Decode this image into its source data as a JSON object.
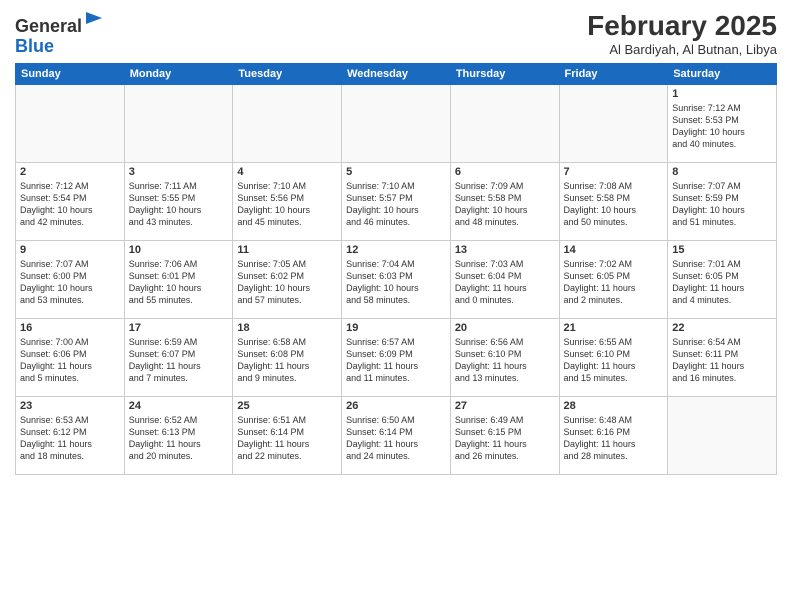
{
  "header": {
    "logo_general": "General",
    "logo_blue": "Blue",
    "month_year": "February 2025",
    "location": "Al Bardiyah, Al Butnan, Libya"
  },
  "weekdays": [
    "Sunday",
    "Monday",
    "Tuesday",
    "Wednesday",
    "Thursday",
    "Friday",
    "Saturday"
  ],
  "weeks": [
    [
      {
        "day": "",
        "info": ""
      },
      {
        "day": "",
        "info": ""
      },
      {
        "day": "",
        "info": ""
      },
      {
        "day": "",
        "info": ""
      },
      {
        "day": "",
        "info": ""
      },
      {
        "day": "",
        "info": ""
      },
      {
        "day": "1",
        "info": "Sunrise: 7:12 AM\nSunset: 5:53 PM\nDaylight: 10 hours\nand 40 minutes."
      }
    ],
    [
      {
        "day": "2",
        "info": "Sunrise: 7:12 AM\nSunset: 5:54 PM\nDaylight: 10 hours\nand 42 minutes."
      },
      {
        "day": "3",
        "info": "Sunrise: 7:11 AM\nSunset: 5:55 PM\nDaylight: 10 hours\nand 43 minutes."
      },
      {
        "day": "4",
        "info": "Sunrise: 7:10 AM\nSunset: 5:56 PM\nDaylight: 10 hours\nand 45 minutes."
      },
      {
        "day": "5",
        "info": "Sunrise: 7:10 AM\nSunset: 5:57 PM\nDaylight: 10 hours\nand 46 minutes."
      },
      {
        "day": "6",
        "info": "Sunrise: 7:09 AM\nSunset: 5:58 PM\nDaylight: 10 hours\nand 48 minutes."
      },
      {
        "day": "7",
        "info": "Sunrise: 7:08 AM\nSunset: 5:58 PM\nDaylight: 10 hours\nand 50 minutes."
      },
      {
        "day": "8",
        "info": "Sunrise: 7:07 AM\nSunset: 5:59 PM\nDaylight: 10 hours\nand 51 minutes."
      }
    ],
    [
      {
        "day": "9",
        "info": "Sunrise: 7:07 AM\nSunset: 6:00 PM\nDaylight: 10 hours\nand 53 minutes."
      },
      {
        "day": "10",
        "info": "Sunrise: 7:06 AM\nSunset: 6:01 PM\nDaylight: 10 hours\nand 55 minutes."
      },
      {
        "day": "11",
        "info": "Sunrise: 7:05 AM\nSunset: 6:02 PM\nDaylight: 10 hours\nand 57 minutes."
      },
      {
        "day": "12",
        "info": "Sunrise: 7:04 AM\nSunset: 6:03 PM\nDaylight: 10 hours\nand 58 minutes."
      },
      {
        "day": "13",
        "info": "Sunrise: 7:03 AM\nSunset: 6:04 PM\nDaylight: 11 hours\nand 0 minutes."
      },
      {
        "day": "14",
        "info": "Sunrise: 7:02 AM\nSunset: 6:05 PM\nDaylight: 11 hours\nand 2 minutes."
      },
      {
        "day": "15",
        "info": "Sunrise: 7:01 AM\nSunset: 6:05 PM\nDaylight: 11 hours\nand 4 minutes."
      }
    ],
    [
      {
        "day": "16",
        "info": "Sunrise: 7:00 AM\nSunset: 6:06 PM\nDaylight: 11 hours\nand 5 minutes."
      },
      {
        "day": "17",
        "info": "Sunrise: 6:59 AM\nSunset: 6:07 PM\nDaylight: 11 hours\nand 7 minutes."
      },
      {
        "day": "18",
        "info": "Sunrise: 6:58 AM\nSunset: 6:08 PM\nDaylight: 11 hours\nand 9 minutes."
      },
      {
        "day": "19",
        "info": "Sunrise: 6:57 AM\nSunset: 6:09 PM\nDaylight: 11 hours\nand 11 minutes."
      },
      {
        "day": "20",
        "info": "Sunrise: 6:56 AM\nSunset: 6:10 PM\nDaylight: 11 hours\nand 13 minutes."
      },
      {
        "day": "21",
        "info": "Sunrise: 6:55 AM\nSunset: 6:10 PM\nDaylight: 11 hours\nand 15 minutes."
      },
      {
        "day": "22",
        "info": "Sunrise: 6:54 AM\nSunset: 6:11 PM\nDaylight: 11 hours\nand 16 minutes."
      }
    ],
    [
      {
        "day": "23",
        "info": "Sunrise: 6:53 AM\nSunset: 6:12 PM\nDaylight: 11 hours\nand 18 minutes."
      },
      {
        "day": "24",
        "info": "Sunrise: 6:52 AM\nSunset: 6:13 PM\nDaylight: 11 hours\nand 20 minutes."
      },
      {
        "day": "25",
        "info": "Sunrise: 6:51 AM\nSunset: 6:14 PM\nDaylight: 11 hours\nand 22 minutes."
      },
      {
        "day": "26",
        "info": "Sunrise: 6:50 AM\nSunset: 6:14 PM\nDaylight: 11 hours\nand 24 minutes."
      },
      {
        "day": "27",
        "info": "Sunrise: 6:49 AM\nSunset: 6:15 PM\nDaylight: 11 hours\nand 26 minutes."
      },
      {
        "day": "28",
        "info": "Sunrise: 6:48 AM\nSunset: 6:16 PM\nDaylight: 11 hours\nand 28 minutes."
      },
      {
        "day": "",
        "info": ""
      }
    ]
  ]
}
